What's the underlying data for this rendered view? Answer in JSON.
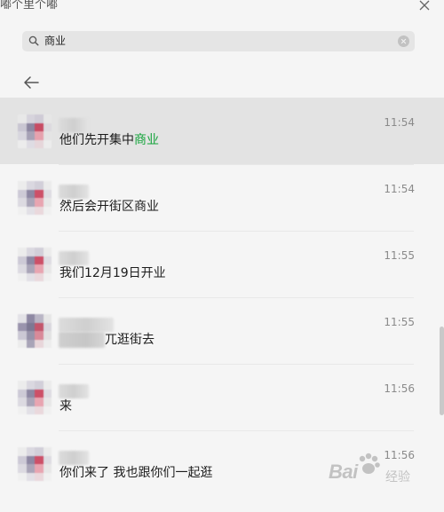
{
  "window": {
    "title": "嘟个里个嘟"
  },
  "search": {
    "query": "商业"
  },
  "results": [
    {
      "time": "11:54",
      "message_before": "他们先开集中",
      "message_highlight": "商业",
      "message_after": "",
      "selected": true
    },
    {
      "time": "11:54",
      "message_before": "然后会开街区商业",
      "message_highlight": "",
      "message_after": "",
      "selected": false
    },
    {
      "time": "11:55",
      "message_before": "我们12月19日开业",
      "message_highlight": "",
      "message_after": "",
      "selected": false
    },
    {
      "time": "11:55",
      "message_before": "",
      "message_highlight": "",
      "message_after": "兀逛街去",
      "selected": false
    },
    {
      "time": "11:56",
      "message_before": "来",
      "message_highlight": "",
      "message_after": "",
      "selected": false
    },
    {
      "time": "11:56",
      "message_before": "你们来了 我也跟你们一起逛",
      "message_highlight": "",
      "message_after": "",
      "selected": false
    }
  ],
  "watermark": {
    "brand": "Bai",
    "suffix": "经验"
  },
  "colors": {
    "highlight": "#13a33a",
    "selected_row": "#e3e3e3",
    "background": "#f5f5f5"
  }
}
